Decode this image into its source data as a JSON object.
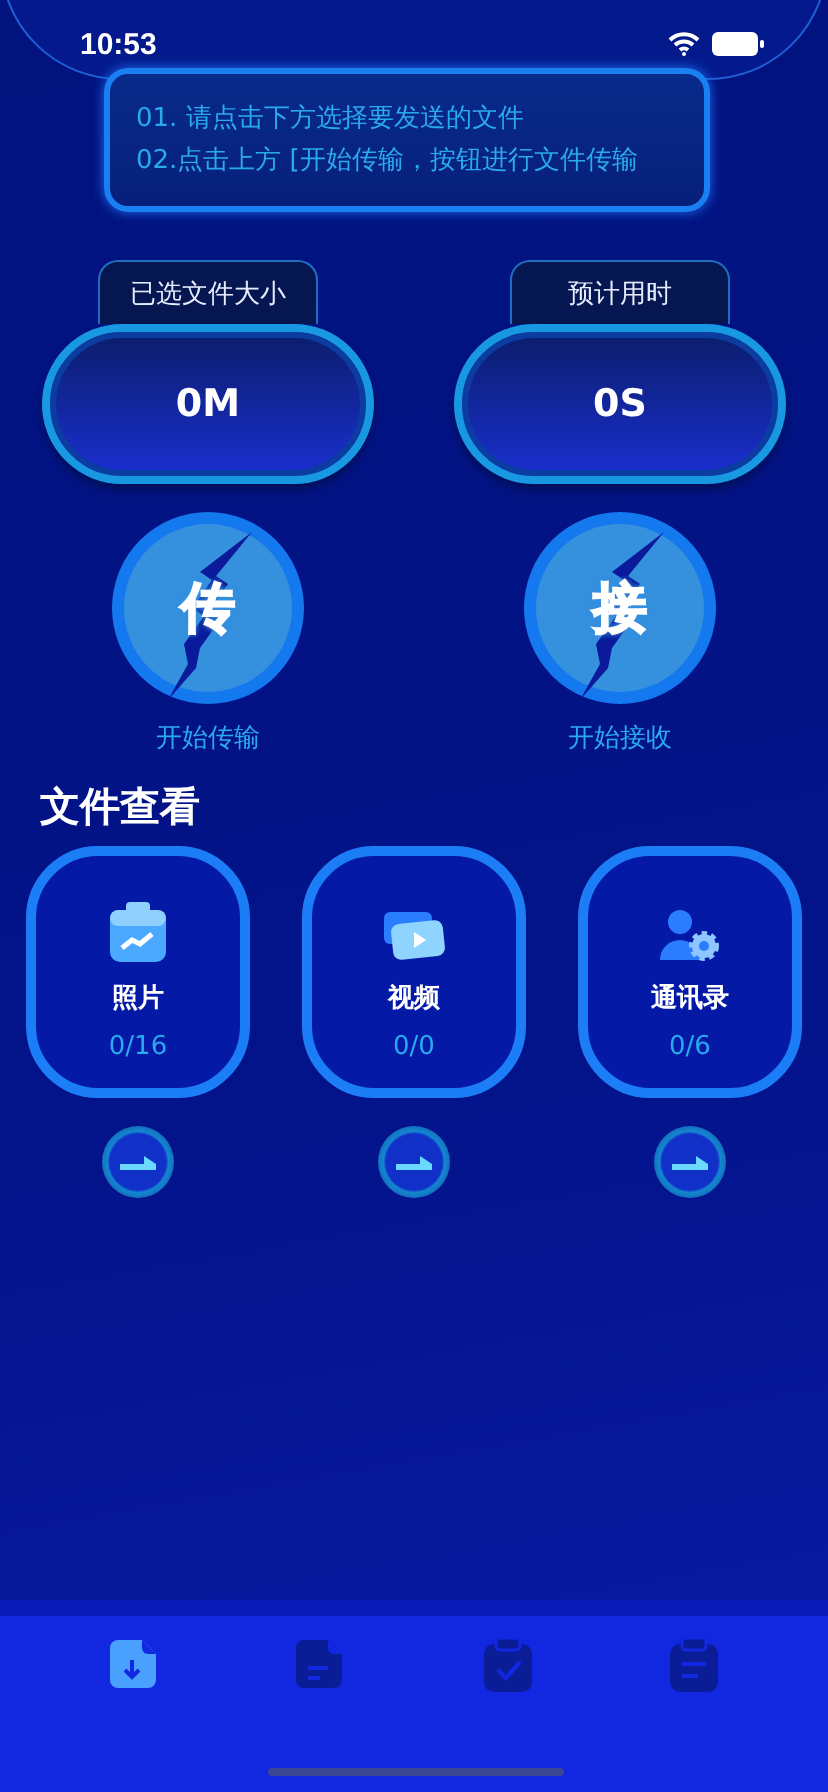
{
  "status_bar": {
    "time": "10:53"
  },
  "notice": {
    "lines": [
      "01. 请点击下方选择要发送的文件",
      "02.点击上方 [开始传输，按钮进行文件传输"
    ]
  },
  "stats": [
    {
      "label": "已选文件大小",
      "value": "0M"
    },
    {
      "label": "预计用时",
      "value": "0S"
    }
  ],
  "actions": [
    {
      "glyph": "传",
      "label": "开始传输"
    },
    {
      "glyph": "接",
      "label": "开始接收"
    }
  ],
  "files_section": {
    "title": "文件查看"
  },
  "file_cards": [
    {
      "kind": "photo",
      "name": "照片",
      "count": "0/16"
    },
    {
      "kind": "video",
      "name": "视频",
      "count": "0/0"
    },
    {
      "kind": "contacts",
      "name": "通讯录",
      "count": "0/6"
    }
  ],
  "tab_bar": [
    {
      "kind": "file-download",
      "selected": true
    },
    {
      "kind": "file-text",
      "selected": false
    },
    {
      "kind": "clipboard-check",
      "selected": false
    },
    {
      "kind": "clipboard-list",
      "selected": false
    }
  ]
}
